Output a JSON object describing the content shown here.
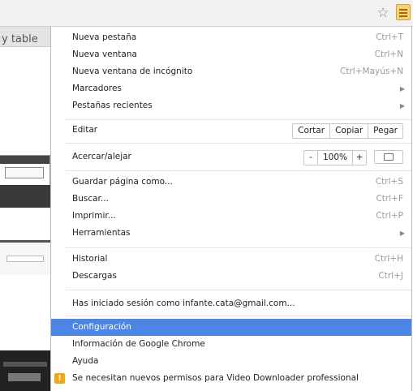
{
  "toolbar": {
    "star_icon": "star-outline",
    "menu_icon": "hamburger-menu"
  },
  "background_page": {
    "visible_text": "y table"
  },
  "menu": {
    "new_tab": {
      "label": "Nueva pestaña",
      "shortcut": "Ctrl+T"
    },
    "new_window": {
      "label": "Nueva ventana",
      "shortcut": "Ctrl+N"
    },
    "incognito": {
      "label": "Nueva ventana de incógnito",
      "shortcut": "Ctrl+Mayús+N"
    },
    "bookmarks": {
      "label": "Marcadores"
    },
    "recent_tabs": {
      "label": "Pestañas recientes"
    },
    "edit": {
      "label": "Editar",
      "cut": "Cortar",
      "copy": "Copiar",
      "paste": "Pegar"
    },
    "zoom": {
      "label": "Acercar/alejar",
      "minus": "-",
      "value": "100%",
      "plus": "+"
    },
    "save_page": {
      "label": "Guardar página como...",
      "shortcut": "Ctrl+S"
    },
    "find": {
      "label": "Buscar...",
      "shortcut": "Ctrl+F"
    },
    "print": {
      "label": "Imprimir...",
      "shortcut": "Ctrl+P"
    },
    "tools": {
      "label": "Herramientas"
    },
    "history": {
      "label": "Historial",
      "shortcut": "Ctrl+H"
    },
    "downloads": {
      "label": "Descargas",
      "shortcut": "Ctrl+J"
    },
    "signed_in": {
      "label": "Has iniciado sesión como infante.cata@gmail.com..."
    },
    "settings": {
      "label": "Configuración"
    },
    "about": {
      "label": "Información de Google Chrome"
    },
    "help": {
      "label": "Ayuda"
    },
    "permissions": {
      "label": "Se necesitan nuevos permisos para Video Downloader professional",
      "icon_glyph": "!"
    }
  },
  "colors": {
    "highlight": "#4c86e5",
    "menu_button": "#f3d37a",
    "warning": "#f1a713"
  }
}
